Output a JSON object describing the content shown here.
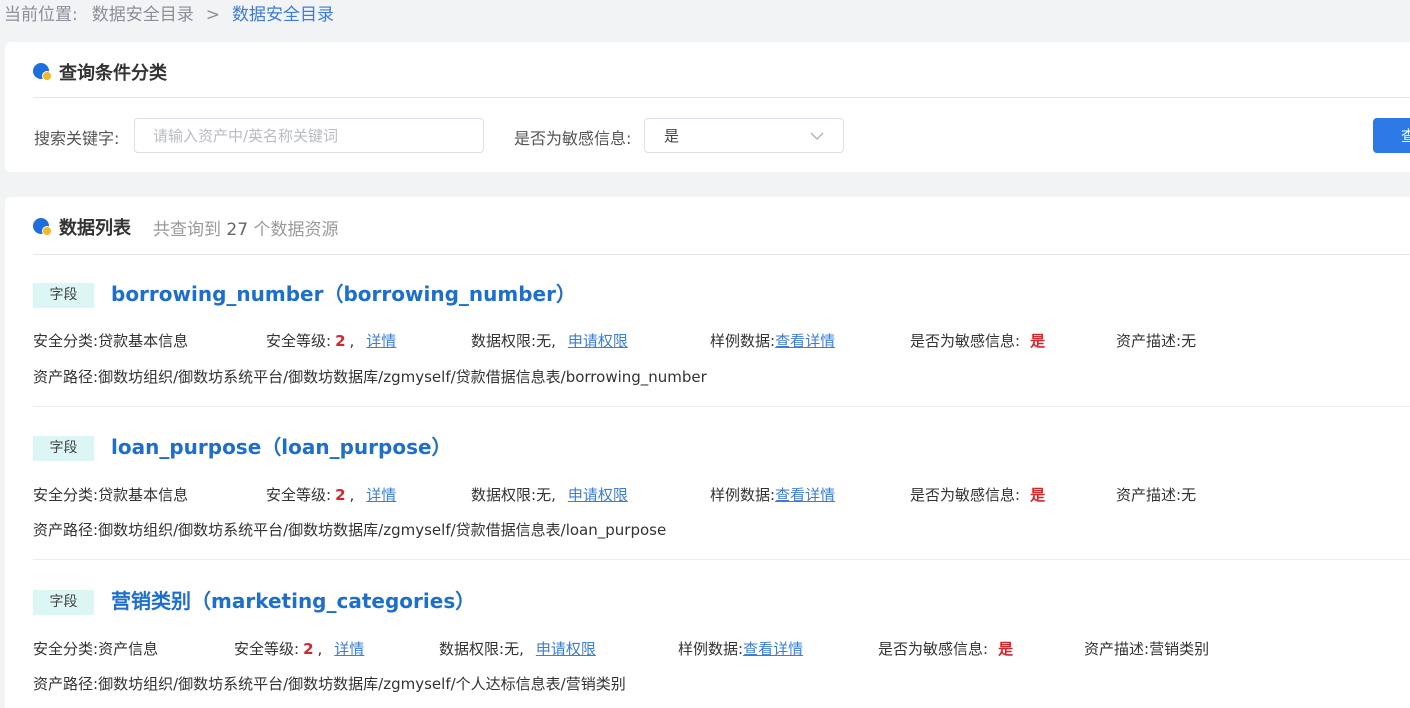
{
  "breadcrumb": {
    "prefix": "当前位置:",
    "level1": "数据安全目录",
    "separator": ">",
    "current": "数据安全目录"
  },
  "query_panel": {
    "title": "查询条件分类",
    "keyword_label": "搜索关键字:",
    "keyword_placeholder": "请输入资产中/英名称关键词",
    "sensitive_label": "是否为敏感信息:",
    "sensitive_value": "是",
    "query_button": "查"
  },
  "list_panel": {
    "title": "数据列表",
    "count_prefix": "共查询到",
    "count": "27",
    "count_suffix": "个数据资源"
  },
  "labels": {
    "security_category": "安全分类:",
    "security_level": "安全等级:",
    "detail_link": "详情",
    "data_permission": "数据权限:",
    "apply_permission": "申请权限",
    "sample_data": "样例数据:",
    "view_detail": "查看详情",
    "is_sensitive": "是否为敏感信息:",
    "asset_desc": "资产描述:",
    "asset_path": "资产路径:",
    "comma": ",",
    "none_value": "无,"
  },
  "items": [
    {
      "tag": "字段",
      "title": "borrowing_number（borrowing_number）",
      "security_category": "贷款基本信息",
      "security_level": "2",
      "sensitive": "是",
      "asset_desc": "无",
      "asset_path": "御数坊组织/御数坊系统平台/御数坊数据库/zgmyself/贷款借据信息表/borrowing_number"
    },
    {
      "tag": "字段",
      "title": "loan_purpose（loan_purpose）",
      "security_category": "贷款基本信息",
      "security_level": "2",
      "sensitive": "是",
      "asset_desc": "无",
      "asset_path": "御数坊组织/御数坊系统平台/御数坊数据库/zgmyself/贷款借据信息表/loan_purpose"
    },
    {
      "tag": "字段",
      "title": "营销类别（marketing_categories）",
      "security_category": "资产信息",
      "security_level": "2",
      "sensitive": "是",
      "asset_desc": "营销类别",
      "asset_path": "御数坊组织/御数坊系统平台/御数坊数据库/zgmyself/个人达标信息表/营销类别"
    }
  ]
}
